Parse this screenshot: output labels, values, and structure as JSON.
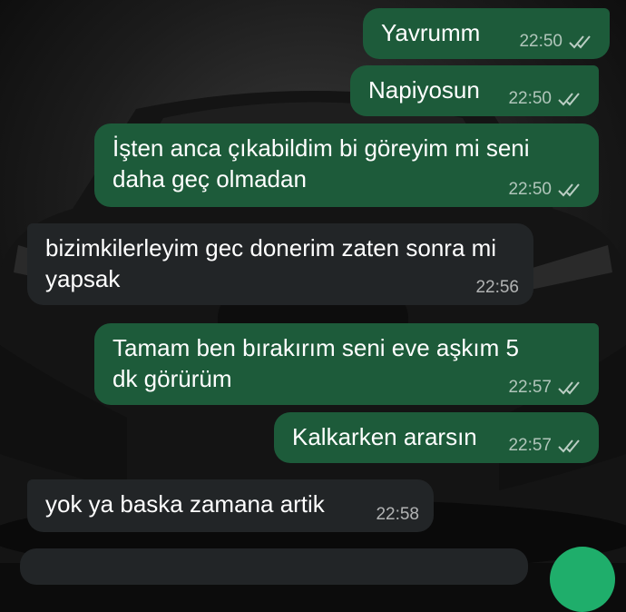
{
  "theme": {
    "outgoing_color": "#1d5b3a",
    "incoming_color": "#222527",
    "fab_color": "#1fae6b",
    "status_icon": "double-check-icon"
  },
  "messages": [
    {
      "direction": "out",
      "text": "Yavrumm",
      "time": "22:50",
      "status": "read"
    },
    {
      "direction": "out",
      "text": "Napiyosun",
      "time": "22:50",
      "status": "read"
    },
    {
      "direction": "out",
      "text": "İşten anca çıkabildim bi göreyim mi seni daha geç olmadan",
      "time": "22:50",
      "status": "read"
    },
    {
      "direction": "in",
      "text": "bizimkilerleyim gec donerim zaten sonra mi yapsak",
      "time": "22:56"
    },
    {
      "direction": "out",
      "text": "Tamam ben bırakırım seni eve aşkım 5 dk görürüm",
      "time": "22:57",
      "status": "read"
    },
    {
      "direction": "out",
      "text": "Kalkarken ararsın",
      "time": "22:57",
      "status": "read"
    },
    {
      "direction": "in",
      "text": "yok ya baska zamana artik",
      "time": "22:58"
    }
  ]
}
